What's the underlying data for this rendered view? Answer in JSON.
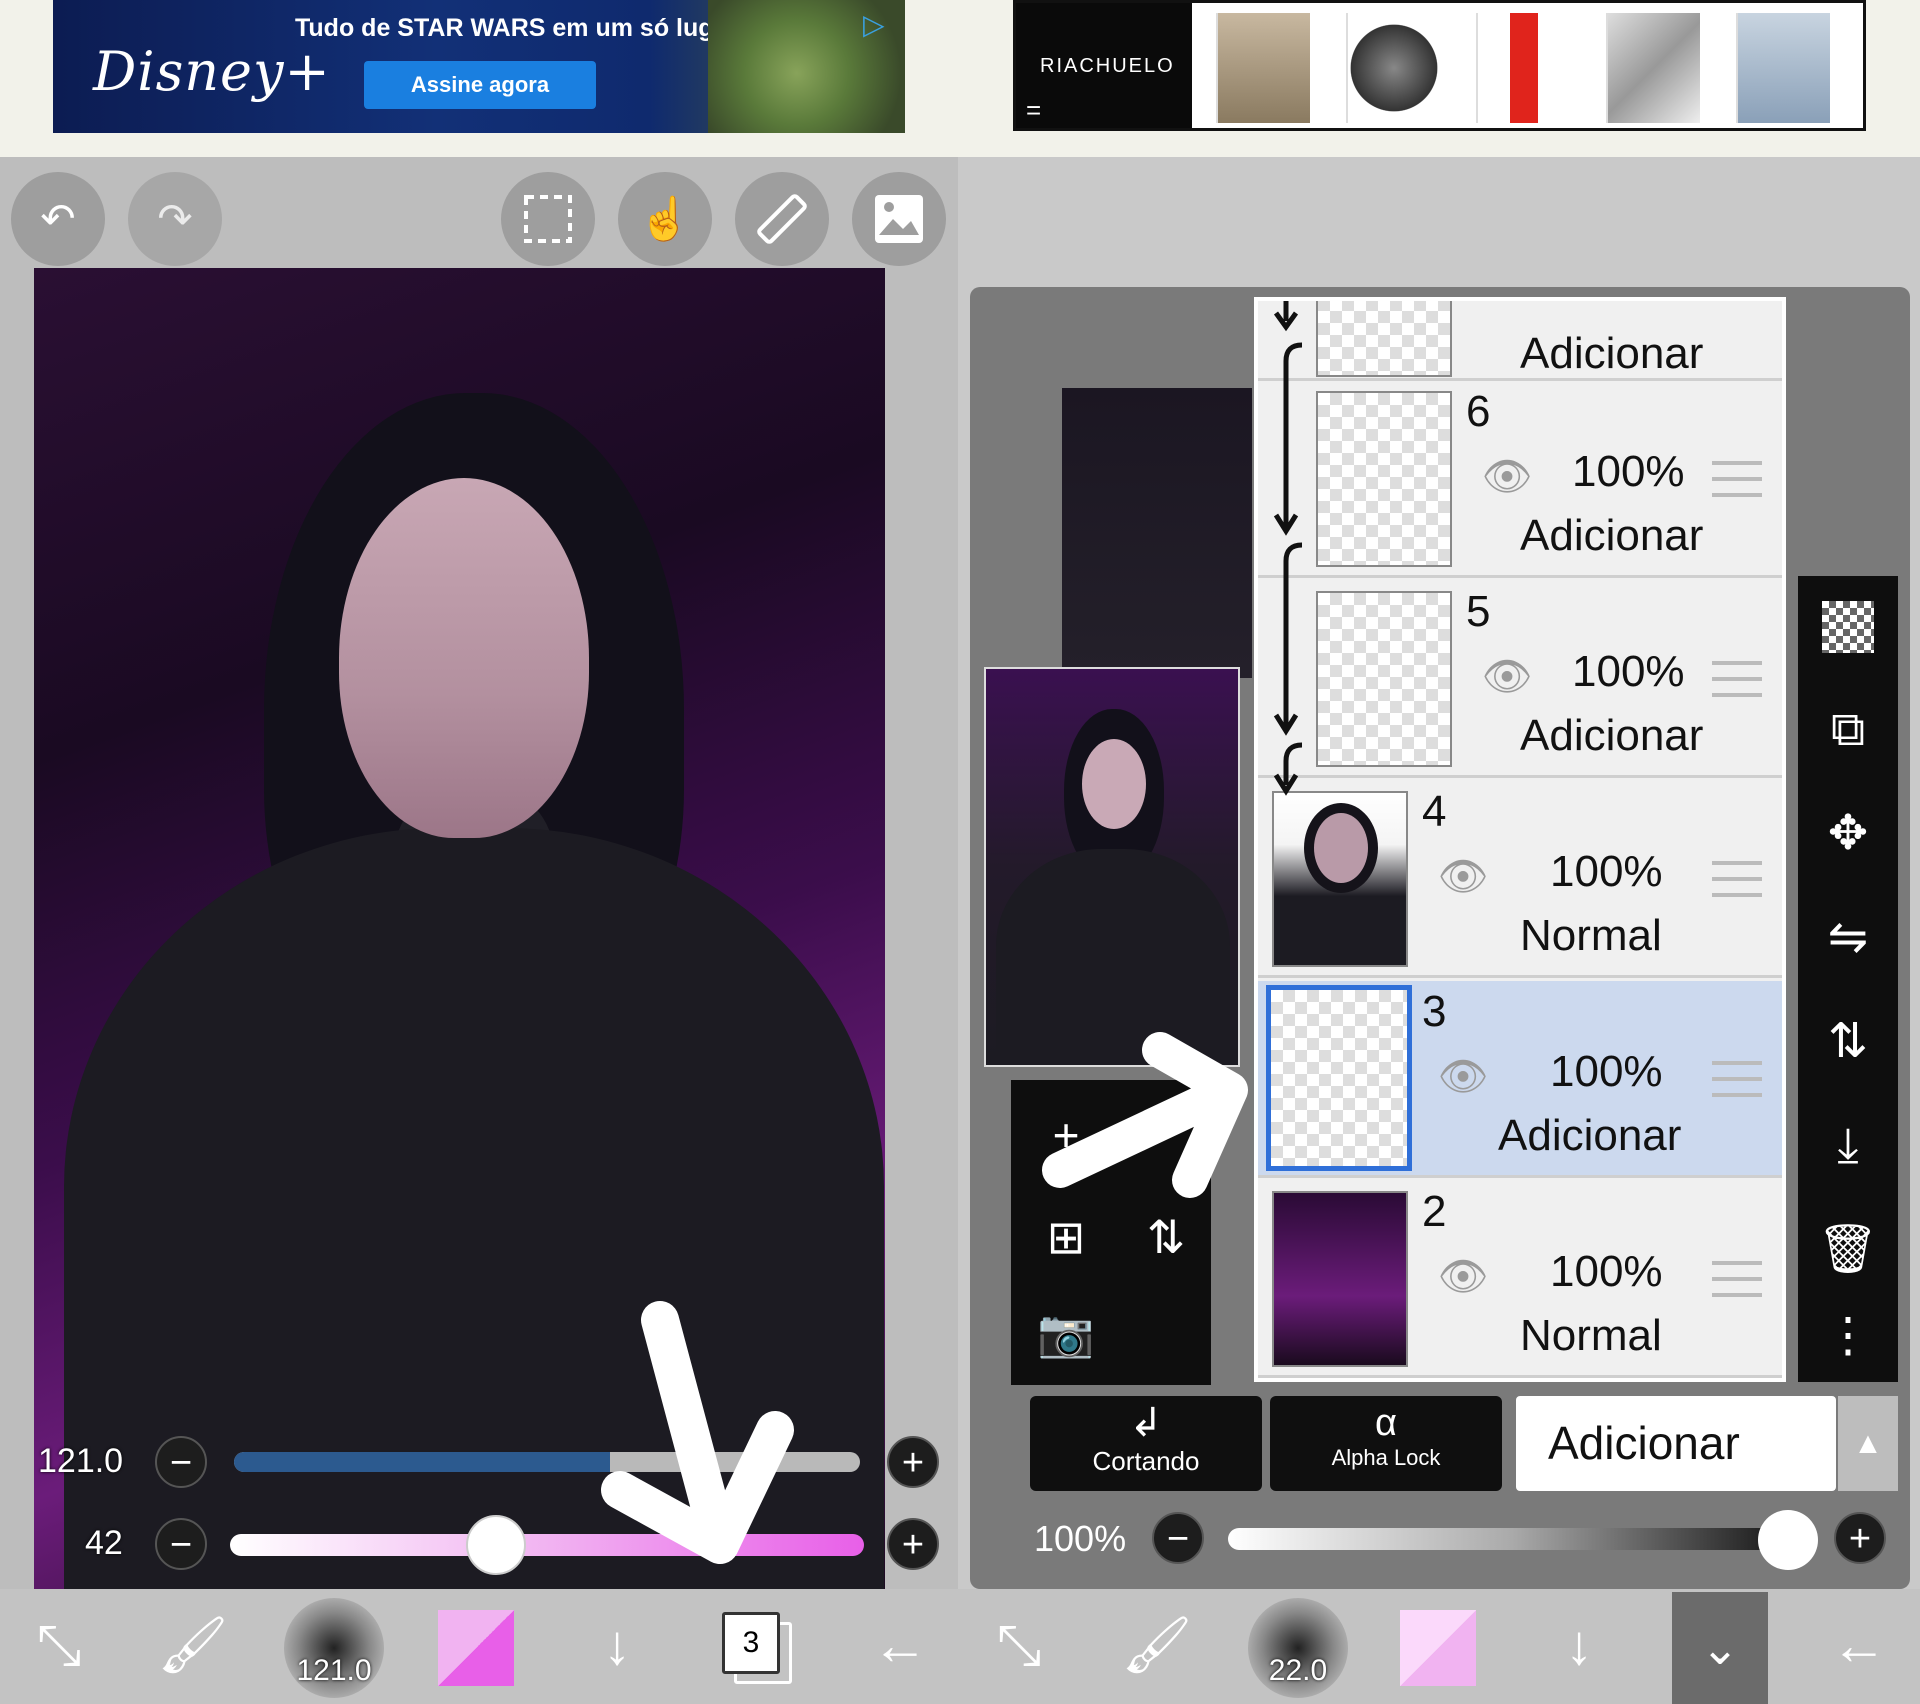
{
  "ads": {
    "disney": {
      "logo": "Disney+",
      "tagline": "Tudo de STAR WARS em um só lugar",
      "cta": "Assine agora"
    },
    "riachuelo": {
      "brand": "RIACHUELO",
      "menu_glyph": "="
    }
  },
  "left": {
    "toolbar": {
      "undo_icon": "↶",
      "redo_icon": "↷"
    },
    "brush_size_value": "121.0",
    "brush_size_fill": 0.6,
    "opacity_value": "42",
    "opacity_fill": 0.42,
    "minus": "−",
    "plus": "+",
    "bottom": {
      "brush_indicator": "121.0",
      "layer_count": "3"
    }
  },
  "right": {
    "layers": [
      {
        "number": "",
        "opacity": "",
        "mode": "Adicionar",
        "selected": false
      },
      {
        "number": "6",
        "opacity": "100%",
        "mode": "Adicionar",
        "selected": false
      },
      {
        "number": "5",
        "opacity": "100%",
        "mode": "Adicionar",
        "selected": false
      },
      {
        "number": "4",
        "opacity": "100%",
        "mode": "Normal",
        "selected": false
      },
      {
        "number": "3",
        "opacity": "100%",
        "mode": "Adicionar",
        "selected": true
      },
      {
        "number": "2",
        "opacity": "100%",
        "mode": "Normal",
        "selected": false
      }
    ],
    "clipping_label": "Cortando",
    "alpha_lock_label": "Alpha Lock",
    "alpha_lock_glyph": "α",
    "blend_mode": "Adicionar",
    "layer_opacity": "100%",
    "bottom": {
      "brush_indicator": "22.0"
    }
  },
  "colors": {
    "brush_color": "#e85fe8",
    "accent_blue": "#2f6fd8",
    "selection_bg": "#ccd9ee"
  }
}
